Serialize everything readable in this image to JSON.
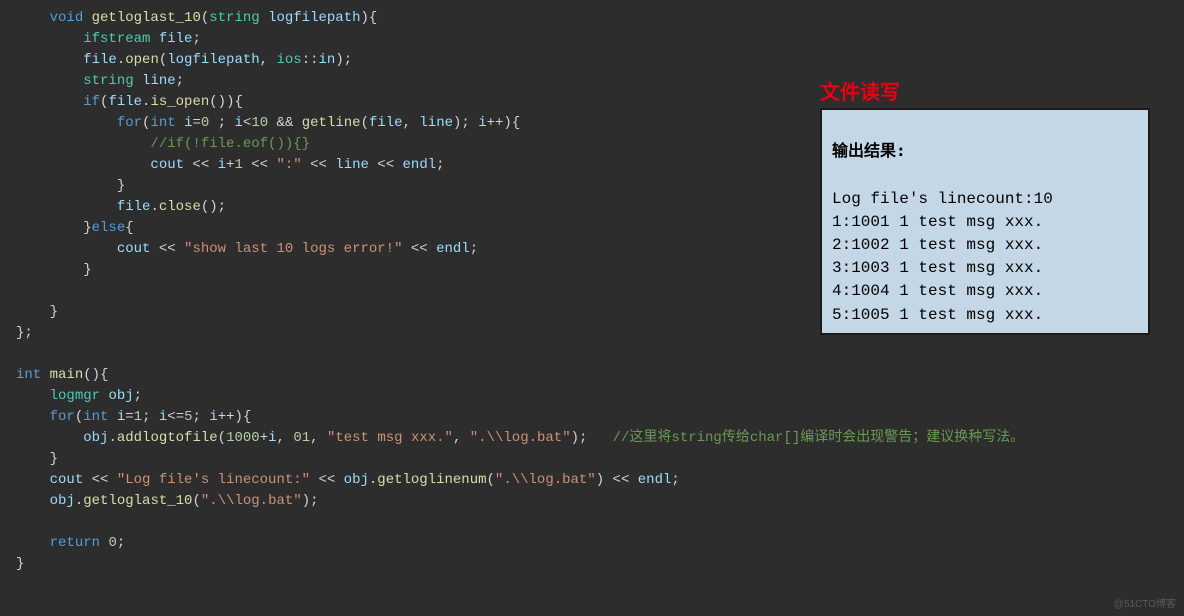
{
  "code": {
    "lines": [
      [
        [
          "    ",
          "punct"
        ],
        [
          "void",
          "keyword"
        ],
        [
          " ",
          "punct"
        ],
        [
          "getloglast_10",
          "func"
        ],
        [
          "(",
          "punct"
        ],
        [
          "string",
          "type"
        ],
        [
          " ",
          "punct"
        ],
        [
          "logfilepath",
          "var"
        ],
        [
          "){",
          "punct"
        ]
      ],
      [
        [
          "        ",
          "punct"
        ],
        [
          "ifstream",
          "type"
        ],
        [
          " ",
          "punct"
        ],
        [
          "file",
          "var"
        ],
        [
          ";",
          "punct"
        ]
      ],
      [
        [
          "        ",
          "punct"
        ],
        [
          "file",
          "var"
        ],
        [
          ".",
          "punct"
        ],
        [
          "open",
          "func"
        ],
        [
          "(",
          "punct"
        ],
        [
          "logfilepath",
          "var"
        ],
        [
          ", ",
          "punct"
        ],
        [
          "ios",
          "type"
        ],
        [
          "::",
          "punct"
        ],
        [
          "in",
          "var"
        ],
        [
          ");",
          "punct"
        ]
      ],
      [
        [
          "        ",
          "punct"
        ],
        [
          "string",
          "type"
        ],
        [
          " ",
          "punct"
        ],
        [
          "line",
          "var"
        ],
        [
          ";",
          "punct"
        ]
      ],
      [
        [
          "        ",
          "punct"
        ],
        [
          "if",
          "keyword"
        ],
        [
          "(",
          "punct"
        ],
        [
          "file",
          "var"
        ],
        [
          ".",
          "punct"
        ],
        [
          "is_open",
          "func"
        ],
        [
          "()){",
          "punct"
        ]
      ],
      [
        [
          "            ",
          "punct"
        ],
        [
          "for",
          "keyword"
        ],
        [
          "(",
          "punct"
        ],
        [
          "int",
          "keyword"
        ],
        [
          " ",
          "punct"
        ],
        [
          "i",
          "var"
        ],
        [
          "=",
          "op"
        ],
        [
          "0",
          "number"
        ],
        [
          " ; ",
          "punct"
        ],
        [
          "i",
          "var"
        ],
        [
          "<",
          "op"
        ],
        [
          "10",
          "number"
        ],
        [
          " && ",
          "op"
        ],
        [
          "getline",
          "func"
        ],
        [
          "(",
          "punct"
        ],
        [
          "file",
          "var"
        ],
        [
          ", ",
          "punct"
        ],
        [
          "line",
          "var"
        ],
        [
          "); ",
          "punct"
        ],
        [
          "i",
          "var"
        ],
        [
          "++){",
          "punct"
        ]
      ],
      [
        [
          "                ",
          "punct"
        ],
        [
          "//if(!file.eof()){}",
          "comment"
        ]
      ],
      [
        [
          "                ",
          "punct"
        ],
        [
          "cout",
          "var"
        ],
        [
          " << ",
          "op"
        ],
        [
          "i",
          "var"
        ],
        [
          "+",
          "op"
        ],
        [
          "1",
          "number"
        ],
        [
          " << ",
          "op"
        ],
        [
          "\":\"",
          "string"
        ],
        [
          " << ",
          "op"
        ],
        [
          "line",
          "var"
        ],
        [
          " << ",
          "op"
        ],
        [
          "endl",
          "var"
        ],
        [
          ";",
          "punct"
        ]
      ],
      [
        [
          "            }",
          "punct"
        ]
      ],
      [
        [
          "            ",
          "punct"
        ],
        [
          "file",
          "var"
        ],
        [
          ".",
          "punct"
        ],
        [
          "close",
          "func"
        ],
        [
          "();",
          "punct"
        ]
      ],
      [
        [
          "        }",
          "punct"
        ],
        [
          "else",
          "keyword"
        ],
        [
          "{",
          "punct"
        ]
      ],
      [
        [
          "            ",
          "punct"
        ],
        [
          "cout",
          "var"
        ],
        [
          " << ",
          "op"
        ],
        [
          "\"show last 10 logs error!\"",
          "string"
        ],
        [
          " << ",
          "op"
        ],
        [
          "endl",
          "var"
        ],
        [
          ";",
          "punct"
        ]
      ],
      [
        [
          "        }",
          "punct"
        ]
      ],
      [
        [
          "",
          "punct"
        ]
      ],
      [
        [
          "    }",
          "punct"
        ]
      ],
      [
        [
          "};",
          "punct"
        ]
      ],
      [
        [
          "",
          "punct"
        ]
      ],
      [
        [
          "int",
          "keyword"
        ],
        [
          " ",
          "punct"
        ],
        [
          "main",
          "func"
        ],
        [
          "(){",
          "punct"
        ]
      ],
      [
        [
          "    ",
          "punct"
        ],
        [
          "logmgr",
          "type"
        ],
        [
          " ",
          "punct"
        ],
        [
          "obj",
          "var"
        ],
        [
          ";",
          "punct"
        ]
      ],
      [
        [
          "    ",
          "punct"
        ],
        [
          "for",
          "keyword"
        ],
        [
          "(",
          "punct"
        ],
        [
          "int",
          "keyword"
        ],
        [
          " ",
          "punct"
        ],
        [
          "i",
          "var"
        ],
        [
          "=",
          "op"
        ],
        [
          "1",
          "number"
        ],
        [
          "; ",
          "punct"
        ],
        [
          "i",
          "var"
        ],
        [
          "<=",
          "op"
        ],
        [
          "5",
          "number"
        ],
        [
          "; ",
          "punct"
        ],
        [
          "i",
          "var"
        ],
        [
          "++){",
          "punct"
        ]
      ],
      [
        [
          "        ",
          "punct"
        ],
        [
          "obj",
          "var"
        ],
        [
          ".",
          "punct"
        ],
        [
          "addlogtofile",
          "func"
        ],
        [
          "(",
          "punct"
        ],
        [
          "1000",
          "number"
        ],
        [
          "+",
          "op"
        ],
        [
          "i",
          "var"
        ],
        [
          ", ",
          "punct"
        ],
        [
          "01",
          "number"
        ],
        [
          ", ",
          "punct"
        ],
        [
          "\"test msg xxx.\"",
          "string"
        ],
        [
          ", ",
          "punct"
        ],
        [
          "\".\\\\log.bat\"",
          "string"
        ],
        [
          ");   ",
          "punct"
        ],
        [
          "//这里将string传给char[]编译时会出现警告；建议换种写法。",
          "comment"
        ]
      ],
      [
        [
          "    }",
          "punct"
        ]
      ],
      [
        [
          "    ",
          "punct"
        ],
        [
          "cout",
          "var"
        ],
        [
          " << ",
          "op"
        ],
        [
          "\"Log file's linecount:\"",
          "string"
        ],
        [
          " << ",
          "op"
        ],
        [
          "obj",
          "var"
        ],
        [
          ".",
          "punct"
        ],
        [
          "getloglinenum",
          "func"
        ],
        [
          "(",
          "punct"
        ],
        [
          "\".\\\\log.bat\"",
          "string"
        ],
        [
          ") << ",
          "punct"
        ],
        [
          "endl",
          "var"
        ],
        [
          ";",
          "punct"
        ]
      ],
      [
        [
          "    ",
          "punct"
        ],
        [
          "obj",
          "var"
        ],
        [
          ".",
          "punct"
        ],
        [
          "getloglast_10",
          "func"
        ],
        [
          "(",
          "punct"
        ],
        [
          "\".\\\\log.bat\"",
          "string"
        ],
        [
          ");",
          "punct"
        ]
      ],
      [
        [
          "",
          "punct"
        ]
      ],
      [
        [
          "    ",
          "punct"
        ],
        [
          "return",
          "keyword"
        ],
        [
          " ",
          "punct"
        ],
        [
          "0",
          "number"
        ],
        [
          ";",
          "punct"
        ]
      ],
      [
        [
          "}",
          "punct"
        ]
      ]
    ]
  },
  "overlay": {
    "title": "文件读写",
    "output_heading": "输出结果:",
    "output_lines": [
      "Log file's linecount:10",
      "1:1001 1 test msg xxx.",
      "2:1002 1 test msg xxx.",
      "3:1003 1 test msg xxx.",
      "4:1004 1 test msg xxx.",
      "5:1005 1 test msg xxx."
    ]
  },
  "watermark": "@51CTO博客"
}
